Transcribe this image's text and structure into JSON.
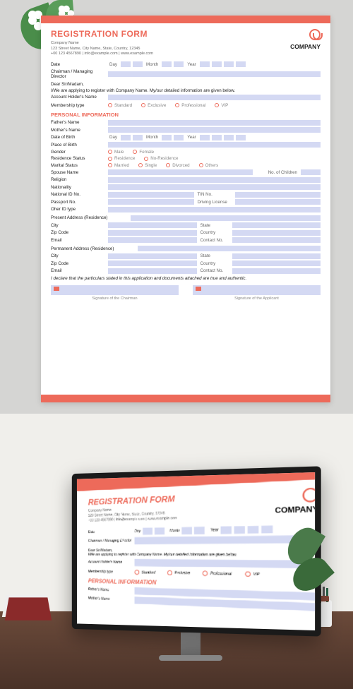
{
  "title": "REGISTRATION FORM",
  "company": {
    "name": "Company Name",
    "address": "123 Street Name, City Name, State, Country, 12345",
    "contact": "+00 123 4567890 | info@example.com | www.example.com",
    "logo_text": "COMPANY"
  },
  "date": {
    "label": "Date",
    "day": "Day",
    "month": "Month",
    "year": "Year"
  },
  "chairman_label": "Chairman / Managing Director",
  "salutation": "Dear Sir/Madam,",
  "intro": "I/We are applying to register with Company Name. My/our detailed information are given below.",
  "account_holder_label": "Account Holder's Name",
  "membership": {
    "label": "Membership type",
    "options": [
      "Standard",
      "Exclusive",
      "Professional",
      "VIP"
    ]
  },
  "sections": {
    "personal": "PERSONAL INFORMATION"
  },
  "fields": {
    "father": "Father's Name",
    "mother": "Mother's Name",
    "dob": "Date of Birth",
    "pob": "Place of Birth",
    "gender": {
      "label": "Gender",
      "options": [
        "Male",
        "Female"
      ]
    },
    "residence": {
      "label": "Residence Status",
      "options": [
        "Residence",
        "No-Residence"
      ]
    },
    "marital": {
      "label": "Marital Status",
      "options": [
        "Married",
        "Single",
        "Divorced",
        "Others"
      ]
    },
    "spouse": "Spouse Name",
    "children": "No. of Children",
    "religion": "Religion",
    "nationality": "Nationality",
    "national_id": "National ID No.",
    "tin": "TIN No.",
    "passport": "Passport No.",
    "license": "Driving License",
    "other_id": "Oher ID type"
  },
  "address": {
    "present": "Present Address (Residence)",
    "permanent": "Permanent Address (Residence)",
    "city": "City",
    "state": "State",
    "zip": "Zip Code",
    "country": "Country",
    "email": "Email",
    "contact": "Contact No."
  },
  "declaration": "I declare that the particulars stated in this application and documents attached are true and authentic.",
  "signatures": {
    "chairman": "Signature of the Chairman",
    "applicant": "Signature of the Applicant"
  }
}
